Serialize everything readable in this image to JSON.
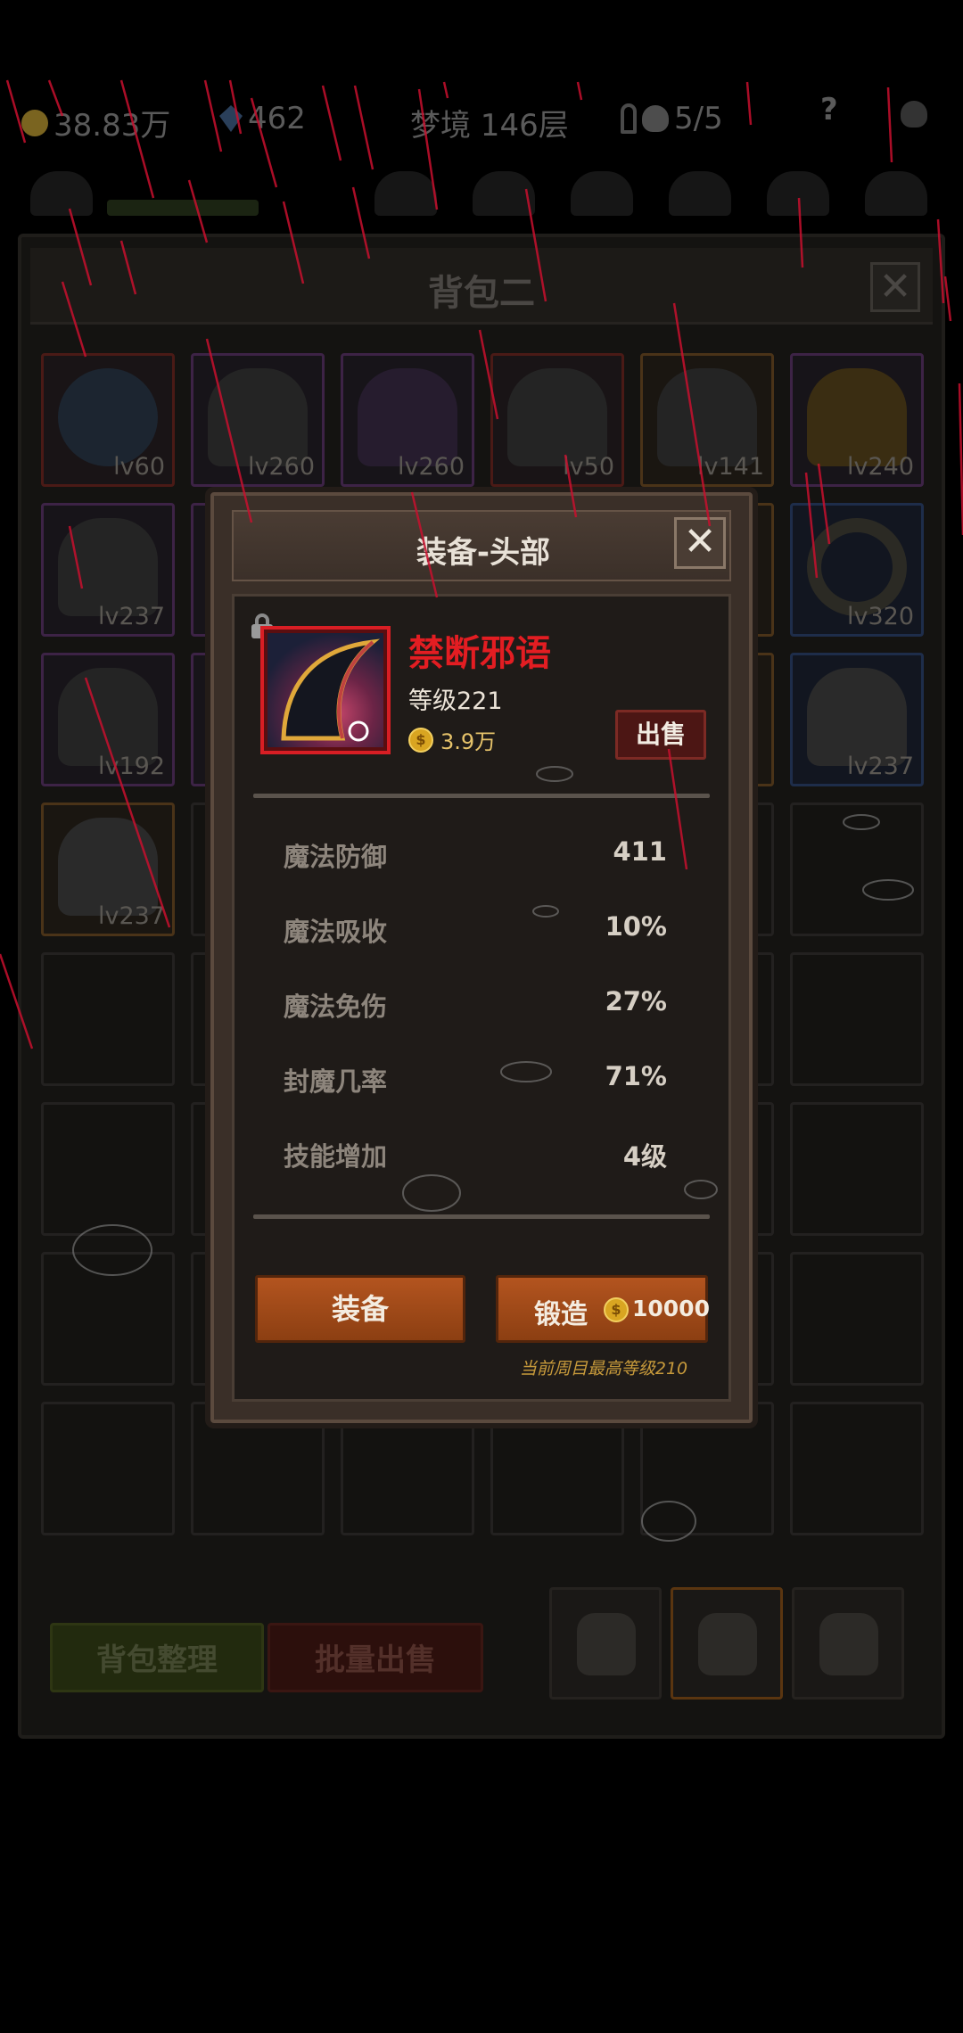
{
  "topbar": {
    "gold": "38.83万",
    "gems": "462",
    "realm": "梦境 146层",
    "keys_skulls": "5/5",
    "help": "?"
  },
  "bag": {
    "title": "背包二",
    "close": "✕",
    "slots": [
      {
        "level": "lv60"
      },
      {
        "level": "lv260"
      },
      {
        "level": "lv260"
      },
      {
        "level": "lv50"
      },
      {
        "level": "lv141"
      },
      {
        "level": "lv240"
      },
      {
        "level": "lv237"
      },
      {
        "level": "lv320"
      },
      {
        "level": "lv192"
      },
      {
        "level": "lv237"
      },
      {
        "level": "lv237"
      }
    ],
    "sort_button": "背包整理",
    "batch_sell_button": "批量出售"
  },
  "modal": {
    "title": "装备-头部",
    "close": "✕",
    "item": {
      "name": "禁断邪语",
      "level": "等级221",
      "price": "3.9万",
      "coin_symbol": "$"
    },
    "sell_button": "出售",
    "stats": [
      {
        "label": "魔法防御",
        "value": "411"
      },
      {
        "label": "魔法吸收",
        "value": "10%"
      },
      {
        "label": "魔法免伤",
        "value": "27%"
      },
      {
        "label": "封魔几率",
        "value": "71%"
      },
      {
        "label": "技能增加",
        "value": "4级"
      }
    ],
    "equip_button": "装备",
    "forge_button": "锻造",
    "forge_cost": "10000",
    "forge_note": "当前周目最高等级210"
  },
  "colors": {
    "item_name": "#e31d22",
    "button_orange": "#b3541f",
    "sell_red": "#4c1614",
    "note_gold": "#c79a3b"
  }
}
